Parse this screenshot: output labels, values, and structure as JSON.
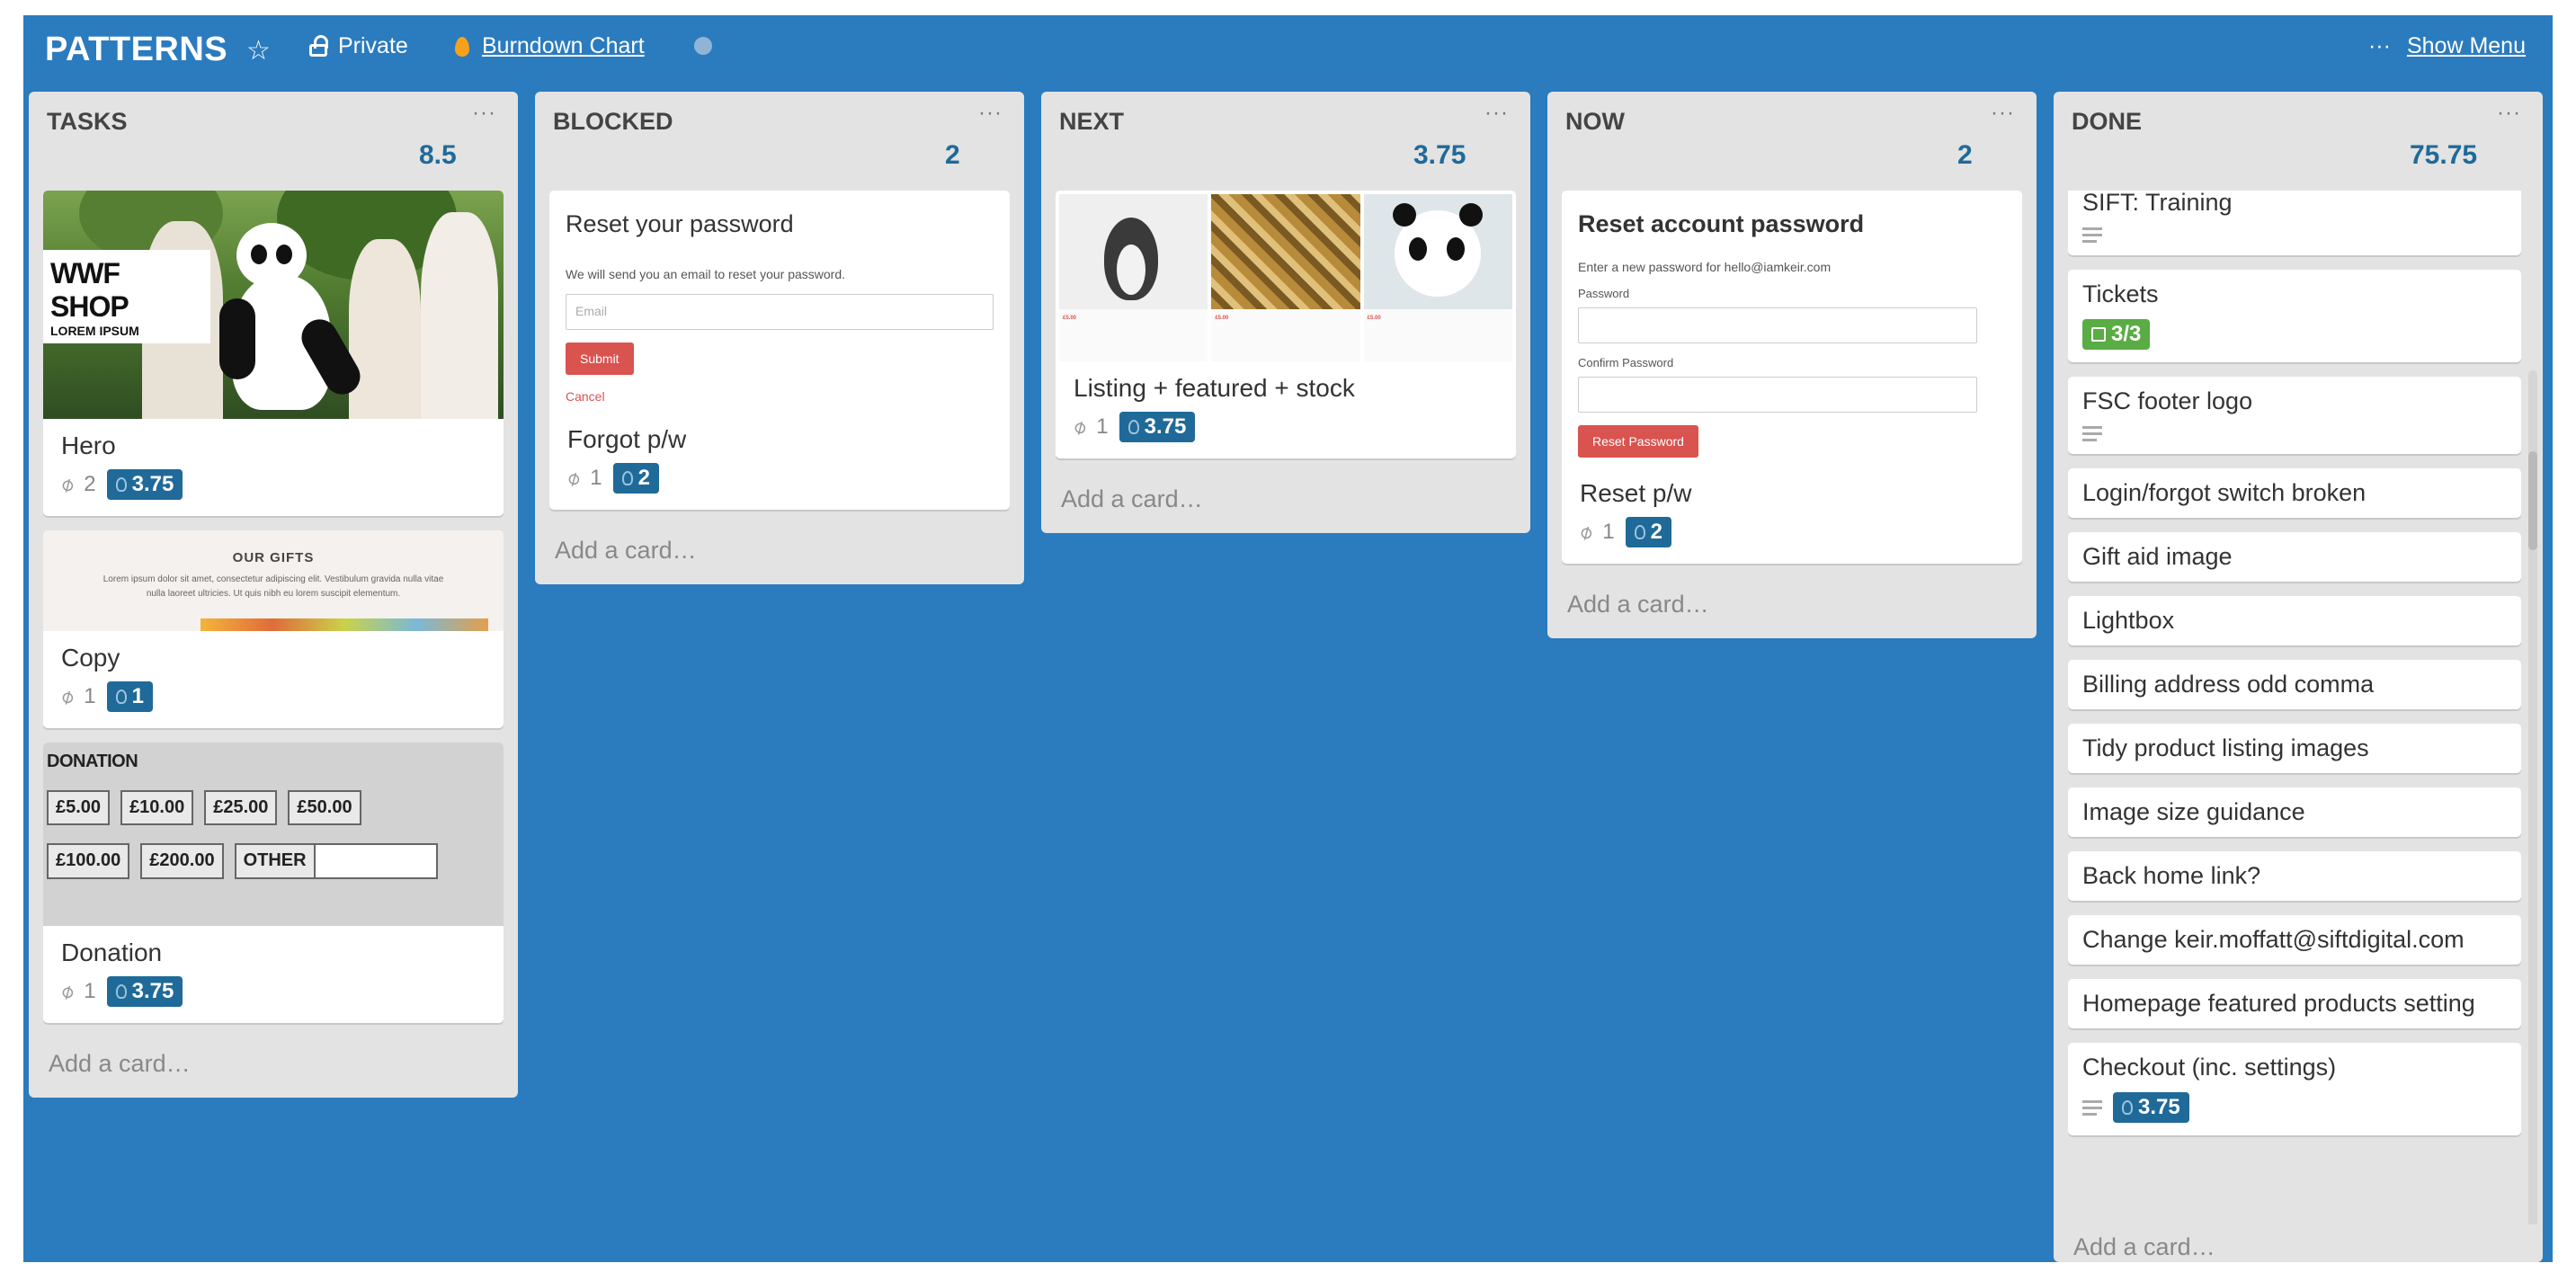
{
  "board": {
    "title": "PATTERNS",
    "visibility": "Private",
    "burndown_link": "Burndown Chart",
    "menu_dots": "···",
    "show_menu": "Show Menu",
    "background_color": "#2b7bbf"
  },
  "lists": {
    "tasks": {
      "name": "TASKS",
      "points": "8.5",
      "menu": "···",
      "add_card": "Add a card…",
      "cards": [
        {
          "title": "Hero",
          "attachments": "2",
          "points": "3.75",
          "cover": {
            "brand": "WWF SHOP",
            "subtitle": "LOREM IPSUM"
          }
        },
        {
          "title": "Copy",
          "attachments": "1",
          "points": "1",
          "cover": {
            "heading": "OUR GIFTS",
            "text": "Lorem ipsum dolor sit amet, consectetur adipiscing elit. Vestibulum gravida nulla vitae nulla laoreet ultricies. Ut quis nibh eu lorem suscipit elementum."
          }
        },
        {
          "title": "Donation",
          "attachments": "1",
          "points": "3.75",
          "cover": {
            "label": "DONATION",
            "row1": [
              "£5.00",
              "£10.00",
              "£25.00",
              "£50.00"
            ],
            "row2": [
              "£100.00",
              "£200.00",
              "OTHER"
            ]
          }
        }
      ]
    },
    "blocked": {
      "name": "BLOCKED",
      "points": "2",
      "menu": "···",
      "add_card": "Add a card…",
      "cards": [
        {
          "title": "Forgot p/w",
          "attachments": "1",
          "points": "2",
          "cover": {
            "heading": "Reset your password",
            "text": "We will send you an email to reset your password.",
            "placeholder": "Email",
            "submit": "Submit",
            "cancel": "Cancel"
          }
        }
      ]
    },
    "next": {
      "name": "NEXT",
      "points": "3.75",
      "menu": "···",
      "add_card": "Add a card…",
      "cards": [
        {
          "title": "Listing + featured + stock",
          "attachments": "1",
          "points": "3.75",
          "cover": {
            "price": "£5.00"
          }
        }
      ]
    },
    "now": {
      "name": "NOW",
      "points": "2",
      "menu": "···",
      "add_card": "Add a card…",
      "cards": [
        {
          "title": "Reset p/w",
          "attachments": "1",
          "points": "2",
          "cover": {
            "heading": "Reset account password",
            "text": "Enter a new password for hello@iamkeir.com",
            "password_label": "Password",
            "confirm_label": "Confirm Password",
            "button": "Reset Password"
          }
        }
      ]
    },
    "done": {
      "name": "DONE",
      "points": "75.75",
      "menu": "···",
      "add_card": "Add a card…",
      "cards": [
        {
          "title": "SIFT: Training"
        },
        {
          "title": "Tickets",
          "checklist": "3/3"
        },
        {
          "title": "FSC footer logo"
        },
        {
          "title": "Login/forgot switch broken"
        },
        {
          "title": "Gift aid image"
        },
        {
          "title": "Lightbox"
        },
        {
          "title": "Billing address odd comma"
        },
        {
          "title": "Tidy product listing images"
        },
        {
          "title": "Image size guidance"
        },
        {
          "title": "Back home link?"
        },
        {
          "title": "Change keir.moffatt@siftdigital.com"
        },
        {
          "title": "Homepage featured products setting"
        },
        {
          "title": "Checkout (inc. settings)",
          "points": "3.75"
        }
      ]
    }
  },
  "icons": [
    "star-icon",
    "lock-icon",
    "flame-icon",
    "clip-icon",
    "bulb-icon",
    "description-icon",
    "checklist-icon"
  ]
}
